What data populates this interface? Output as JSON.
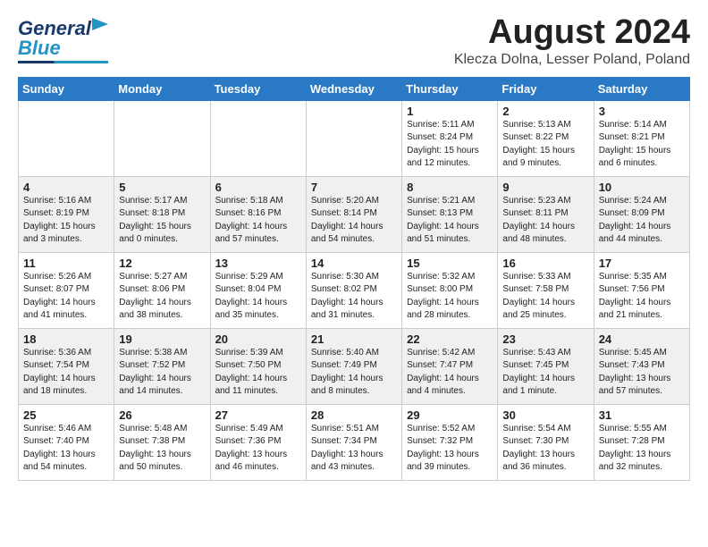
{
  "header": {
    "logo_word1": "General",
    "logo_word2": "Blue",
    "title": "August 2024",
    "subtitle": "Klecza Dolna, Lesser Poland, Poland"
  },
  "calendar": {
    "days_of_week": [
      "Sunday",
      "Monday",
      "Tuesday",
      "Wednesday",
      "Thursday",
      "Friday",
      "Saturday"
    ],
    "weeks": [
      [
        {
          "day": "",
          "info": ""
        },
        {
          "day": "",
          "info": ""
        },
        {
          "day": "",
          "info": ""
        },
        {
          "day": "",
          "info": ""
        },
        {
          "day": "1",
          "info": "Sunrise: 5:11 AM\nSunset: 8:24 PM\nDaylight: 15 hours\nand 12 minutes."
        },
        {
          "day": "2",
          "info": "Sunrise: 5:13 AM\nSunset: 8:22 PM\nDaylight: 15 hours\nand 9 minutes."
        },
        {
          "day": "3",
          "info": "Sunrise: 5:14 AM\nSunset: 8:21 PM\nDaylight: 15 hours\nand 6 minutes."
        }
      ],
      [
        {
          "day": "4",
          "info": "Sunrise: 5:16 AM\nSunset: 8:19 PM\nDaylight: 15 hours\nand 3 minutes."
        },
        {
          "day": "5",
          "info": "Sunrise: 5:17 AM\nSunset: 8:18 PM\nDaylight: 15 hours\nand 0 minutes."
        },
        {
          "day": "6",
          "info": "Sunrise: 5:18 AM\nSunset: 8:16 PM\nDaylight: 14 hours\nand 57 minutes."
        },
        {
          "day": "7",
          "info": "Sunrise: 5:20 AM\nSunset: 8:14 PM\nDaylight: 14 hours\nand 54 minutes."
        },
        {
          "day": "8",
          "info": "Sunrise: 5:21 AM\nSunset: 8:13 PM\nDaylight: 14 hours\nand 51 minutes."
        },
        {
          "day": "9",
          "info": "Sunrise: 5:23 AM\nSunset: 8:11 PM\nDaylight: 14 hours\nand 48 minutes."
        },
        {
          "day": "10",
          "info": "Sunrise: 5:24 AM\nSunset: 8:09 PM\nDaylight: 14 hours\nand 44 minutes."
        }
      ],
      [
        {
          "day": "11",
          "info": "Sunrise: 5:26 AM\nSunset: 8:07 PM\nDaylight: 14 hours\nand 41 minutes."
        },
        {
          "day": "12",
          "info": "Sunrise: 5:27 AM\nSunset: 8:06 PM\nDaylight: 14 hours\nand 38 minutes."
        },
        {
          "day": "13",
          "info": "Sunrise: 5:29 AM\nSunset: 8:04 PM\nDaylight: 14 hours\nand 35 minutes."
        },
        {
          "day": "14",
          "info": "Sunrise: 5:30 AM\nSunset: 8:02 PM\nDaylight: 14 hours\nand 31 minutes."
        },
        {
          "day": "15",
          "info": "Sunrise: 5:32 AM\nSunset: 8:00 PM\nDaylight: 14 hours\nand 28 minutes."
        },
        {
          "day": "16",
          "info": "Sunrise: 5:33 AM\nSunset: 7:58 PM\nDaylight: 14 hours\nand 25 minutes."
        },
        {
          "day": "17",
          "info": "Sunrise: 5:35 AM\nSunset: 7:56 PM\nDaylight: 14 hours\nand 21 minutes."
        }
      ],
      [
        {
          "day": "18",
          "info": "Sunrise: 5:36 AM\nSunset: 7:54 PM\nDaylight: 14 hours\nand 18 minutes."
        },
        {
          "day": "19",
          "info": "Sunrise: 5:38 AM\nSunset: 7:52 PM\nDaylight: 14 hours\nand 14 minutes."
        },
        {
          "day": "20",
          "info": "Sunrise: 5:39 AM\nSunset: 7:50 PM\nDaylight: 14 hours\nand 11 minutes."
        },
        {
          "day": "21",
          "info": "Sunrise: 5:40 AM\nSunset: 7:49 PM\nDaylight: 14 hours\nand 8 minutes."
        },
        {
          "day": "22",
          "info": "Sunrise: 5:42 AM\nSunset: 7:47 PM\nDaylight: 14 hours\nand 4 minutes."
        },
        {
          "day": "23",
          "info": "Sunrise: 5:43 AM\nSunset: 7:45 PM\nDaylight: 14 hours\nand 1 minute."
        },
        {
          "day": "24",
          "info": "Sunrise: 5:45 AM\nSunset: 7:43 PM\nDaylight: 13 hours\nand 57 minutes."
        }
      ],
      [
        {
          "day": "25",
          "info": "Sunrise: 5:46 AM\nSunset: 7:40 PM\nDaylight: 13 hours\nand 54 minutes."
        },
        {
          "day": "26",
          "info": "Sunrise: 5:48 AM\nSunset: 7:38 PM\nDaylight: 13 hours\nand 50 minutes."
        },
        {
          "day": "27",
          "info": "Sunrise: 5:49 AM\nSunset: 7:36 PM\nDaylight: 13 hours\nand 46 minutes."
        },
        {
          "day": "28",
          "info": "Sunrise: 5:51 AM\nSunset: 7:34 PM\nDaylight: 13 hours\nand 43 minutes."
        },
        {
          "day": "29",
          "info": "Sunrise: 5:52 AM\nSunset: 7:32 PM\nDaylight: 13 hours\nand 39 minutes."
        },
        {
          "day": "30",
          "info": "Sunrise: 5:54 AM\nSunset: 7:30 PM\nDaylight: 13 hours\nand 36 minutes."
        },
        {
          "day": "31",
          "info": "Sunrise: 5:55 AM\nSunset: 7:28 PM\nDaylight: 13 hours\nand 32 minutes."
        }
      ]
    ]
  }
}
